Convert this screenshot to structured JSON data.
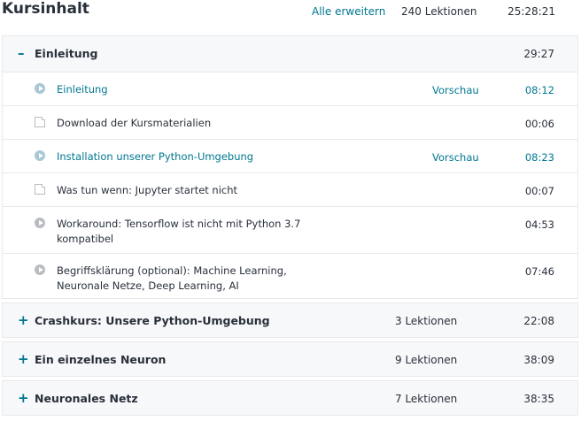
{
  "header": {
    "title": "Kursinhalt",
    "expand_all": "Alle erweitern",
    "lectures": "240 Lektionen",
    "duration": "25:28:21"
  },
  "sections": [
    {
      "toggle": "–",
      "name": "Einleitung",
      "duration": "29:27",
      "lectures": [
        {
          "name": "Einleitung",
          "preview": "Vorschau",
          "duration": "08:12"
        },
        {
          "name": "Download der Kursmaterialien",
          "duration": "00:06"
        },
        {
          "name": "Installation unserer Python-Umgebung",
          "preview": "Vorschau",
          "duration": "08:23"
        },
        {
          "name": "Was tun wenn: Jupyter startet nicht",
          "duration": "00:07"
        },
        {
          "name": "Workaround: Tensorflow ist nicht mit Python 3.7 kompatibel",
          "duration": "04:53"
        },
        {
          "name": "Begriffsklärung (optional): Machine Learning, Neuronale Netze, Deep Learning, AI",
          "duration": "07:46"
        }
      ]
    },
    {
      "toggle": "+",
      "name": "Crashkurs: Unsere Python-Umgebung",
      "count": "3 Lektionen",
      "duration": "22:08"
    },
    {
      "toggle": "+",
      "name": "Ein einzelnes Neuron",
      "count": "9 Lektionen",
      "duration": "38:09"
    },
    {
      "toggle": "+",
      "name": "Neuronales Netz",
      "count": "7 Lektionen",
      "duration": "38:35"
    }
  ]
}
